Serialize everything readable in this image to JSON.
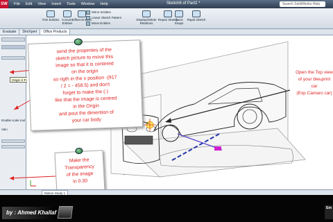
{
  "app": {
    "brand": "SW",
    "menu": [
      "File",
      "Edit",
      "View",
      "Insert",
      "Tools",
      "Window",
      "Help"
    ],
    "document_title": "Sketch6 of Part2 *",
    "search_placeholder": "Search SolidWorks Help"
  },
  "ribbon": {
    "buttons": [
      {
        "label": "Trim Entities"
      },
      {
        "label": "Convert Entities"
      },
      {
        "label": "Offset Entities"
      },
      {
        "label": "Display/Delete Relations"
      },
      {
        "label": "Repair Sketch"
      },
      {
        "label": "Quick Snaps"
      },
      {
        "label": "Rapid Sketch"
      }
    ],
    "small_items": [
      "Mirror Entities",
      "Linear Sketch Pattern",
      "Move Entities"
    ]
  },
  "tabs": [
    "Evaluate",
    "DimXpert",
    "Office Products"
  ],
  "left_panel": {
    "tooltip": "Origin X Pos",
    "scale_tool": "Enable scale tool",
    "aspect_ratio": "ratio",
    "transparency_value": "0.30"
  },
  "annotations": {
    "main_note": [
      "send the properties of the",
      "sketch picture to move this",
      "image so that it is centered",
      "on the origin",
      "so rigth in the x position   -(917",
      "/ 2 = - 458.5) and don't",
      "forget to make the (-)",
      "like that the image is centred",
      "in the Origin",
      "and pout the dimention of",
      "your car body"
    ],
    "side_note": [
      "Open the Top view",
      "of your bleuprint",
      "car",
      "(Exp Camaro car)"
    ],
    "transparency_note": [
      "Make the",
      "Transparency",
      "of the image",
      "in 0.30"
    ]
  },
  "status_bar": {
    "motion_tab": "Motion Study 1"
  },
  "footer": {
    "author": "by : Ahmed Khallaf",
    "corner_logo": "Em"
  },
  "colors": {
    "annotation_red": "#e02020",
    "arrow_blue": "#2233aa",
    "selection_magenta": "#d020d0"
  }
}
